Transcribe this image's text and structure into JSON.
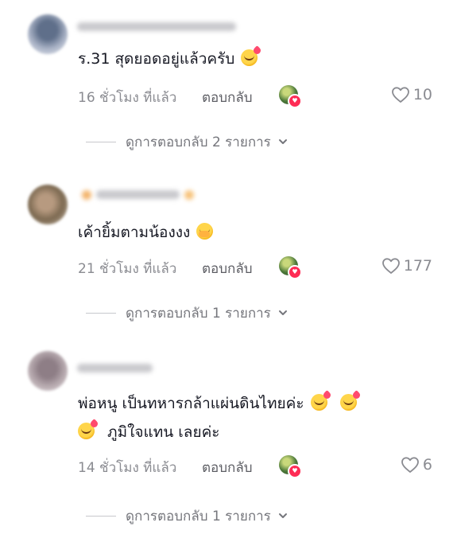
{
  "comments": [
    {
      "text": "ร.31 สุดยอดอยู่แล้วครับ",
      "emoji": "smiling-hearts-emoji",
      "time": "16 ชั่วโมง ที่แล้ว",
      "reply_label": "ตอบกลับ",
      "likes": "10",
      "view_replies": "ดูการตอบกลับ 2 รายการ"
    },
    {
      "text": "เค้ายิ้มตามน้องงง",
      "emoji": "face-with-hand-over-mouth-emoji",
      "time": "21 ชั่วโมง ที่แล้ว",
      "reply_label": "ตอบกลับ",
      "likes": "177",
      "view_replies": "ดูการตอบกลับ 1 รายการ"
    },
    {
      "text_line1": "พ่อหนู เป็นทหารกล้าแผ่นดินไทยค่ะ",
      "text_line2": "ภูมิใจแทน เลยค่ะ",
      "emoji": "smiling-hearts-emoji",
      "time": "14 ชั่วโมง ที่แล้ว",
      "reply_label": "ตอบกลับ",
      "likes": "6",
      "view_replies": "ดูการตอบกลับ 1 รายการ"
    }
  ],
  "colors": {
    "text": "#161823",
    "meta": "#8a8b91",
    "creator_heart": "#fe2c55"
  }
}
